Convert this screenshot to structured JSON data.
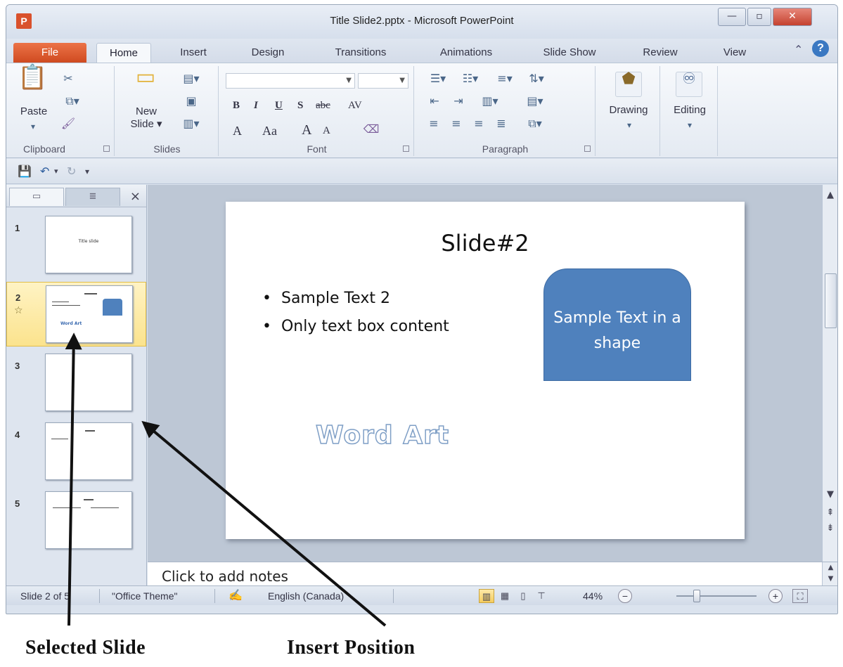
{
  "window": {
    "title": "Title Slide2.pptx - Microsoft PowerPoint",
    "app_icon": "P",
    "min": "—",
    "max": "▫",
    "close": "✕"
  },
  "ribbon_tabs": [
    "File",
    "Home",
    "Insert",
    "Design",
    "Transitions",
    "Animations",
    "Slide Show",
    "Review",
    "View"
  ],
  "ribbon": {
    "clipboard": {
      "label": "Clipboard",
      "paste": "Paste"
    },
    "slides": {
      "label": "Slides",
      "new_slide_1": "New",
      "new_slide_2": "Slide ▾"
    },
    "font": {
      "label": "Font",
      "bold": "B",
      "italic": "I",
      "underline": "U",
      "shadow": "S",
      "strike": "abc",
      "spacing": "AV",
      "color": "A",
      "case": "Aa",
      "grow": "A",
      "shrink": "A"
    },
    "paragraph": {
      "label": "Paragraph"
    },
    "drawing": {
      "label": "Drawing"
    },
    "editing": {
      "label": "Editing"
    }
  },
  "left_pane": {
    "slides": [
      {
        "num": "1",
        "thumb_text": "Title slide"
      },
      {
        "num": "2",
        "thumb_text": "Word Art"
      },
      {
        "num": "3",
        "thumb_text": ""
      },
      {
        "num": "4",
        "thumb_text": ""
      },
      {
        "num": "5",
        "thumb_text": ""
      }
    ],
    "close": "×",
    "star": "☆"
  },
  "slide": {
    "title": "Slide#2",
    "bullets": [
      "Sample Text 2",
      "Only text box content"
    ],
    "shape_text": "Sample Text in a shape",
    "wordart": "Word Art"
  },
  "notes": {
    "placeholder": "Click to add notes"
  },
  "status": {
    "slide_pos": "Slide 2 of 5",
    "theme": "\"Office Theme\"",
    "language": "English (Canada)",
    "zoom": "44%",
    "zoom_minus": "−",
    "zoom_plus": "+"
  },
  "annotations": {
    "selected": "Selected Slide",
    "insert": "Insert Position"
  },
  "colors": {
    "shape_fill": "#4f81bd",
    "file_tab": "#d9512c",
    "selection": "#fbe38d"
  }
}
